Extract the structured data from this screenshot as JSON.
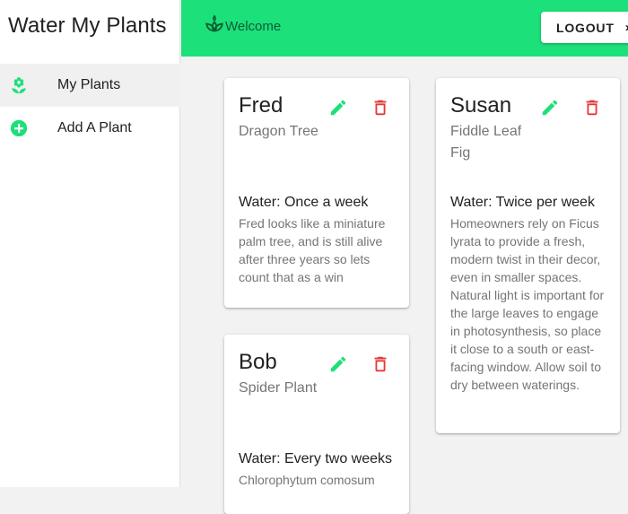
{
  "app": {
    "title": "Water My Plants"
  },
  "sidebar": {
    "items": [
      {
        "label": "My Plants",
        "icon": "flower-icon",
        "active": true
      },
      {
        "label": "Add A Plant",
        "icon": "add-circle-icon",
        "active": false
      }
    ]
  },
  "header": {
    "welcome": "Welcome",
    "logout_label": "LOGOUT",
    "logout_icon": "chevron-right-icon",
    "bg_color": "#1ce07a"
  },
  "colors": {
    "accent": "#1ce07a",
    "edit": "#1ce07a",
    "delete": "#e53935"
  },
  "plants": [
    {
      "name": "Fred",
      "species": "Dragon Tree",
      "water": "Water: Once a week",
      "description": "Fred looks like a miniature palm tree, and is still alive after three years so lets count that as a win"
    },
    {
      "name": "Susan",
      "species": "Fiddle Leaf Fig",
      "water": "Water: Twice per week",
      "description": "Homeowners rely on Ficus lyrata to provide a fresh, modern twist in their decor, even in smaller spaces. Natural light is important for the large leaves to engage in photosynthesis, so place it close to a south or east-facing window. Allow soil to dry between waterings."
    },
    {
      "name": "Bob",
      "species": "Spider Plant",
      "water": "Water: Every two weeks",
      "description": "Chlorophytum comosum"
    }
  ]
}
